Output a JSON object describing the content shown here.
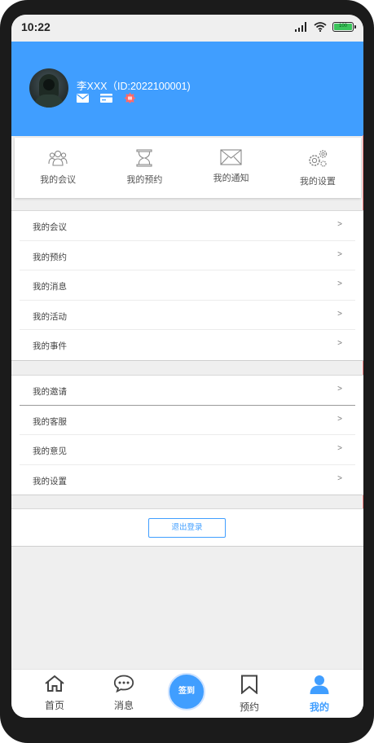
{
  "status_bar": {
    "time": "10:22",
    "battery_text": "100"
  },
  "profile": {
    "name": "李XXX（ID:2022100001)"
  },
  "quick_actions": [
    {
      "label": "我的会议",
      "icon": "people-icon"
    },
    {
      "label": "我的预约",
      "icon": "hourglass-icon"
    },
    {
      "label": "我的通知",
      "icon": "envelope-icon"
    },
    {
      "label": "我的设置",
      "icon": "gears-icon"
    }
  ],
  "menu_group_1": [
    {
      "label": "我的会议",
      "arrow": ">"
    },
    {
      "label": "我的预约",
      "arrow": ">"
    },
    {
      "label": "我的消息",
      "arrow": ">"
    },
    {
      "label": "我的活动",
      "arrow": ">"
    },
    {
      "label": "我的事件",
      "arrow": ">"
    }
  ],
  "menu_group_2": [
    {
      "label": "我的邀请",
      "arrow": ">"
    },
    {
      "label": "我的客服",
      "arrow": ">"
    },
    {
      "label": "我的意见",
      "arrow": ">"
    },
    {
      "label": "我的设置",
      "arrow": ">"
    }
  ],
  "logout_label": "退出登录",
  "tabbar": {
    "home": "首页",
    "messages": "消息",
    "checkin": "签到",
    "booking": "预约",
    "mine": "我的"
  },
  "colors": {
    "accent": "#409eff",
    "battery": "#3bc45b",
    "warn_icon": "#ff6b6b"
  }
}
